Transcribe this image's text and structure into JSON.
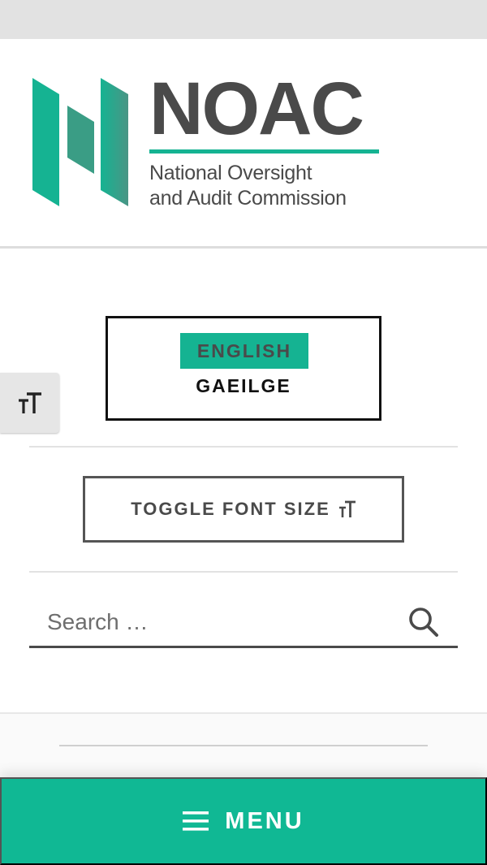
{
  "header": {
    "logo_word": "NOAC",
    "logo_sub_line1": "National Oversight",
    "logo_sub_line2": "and Audit Commission"
  },
  "language": {
    "english_label": "ENGLISH",
    "gaeilge_label": "GAEILGE",
    "selected": "ENGLISH"
  },
  "accessibility": {
    "toggle_font_label": "TOGGLE FONT SIZE",
    "tab_icon": "text-size-icon"
  },
  "search": {
    "placeholder": "Search …",
    "icon": "search-icon"
  },
  "menu": {
    "label": "MENU",
    "icon": "hamburger-icon"
  },
  "colors": {
    "brand_green": "#15b392",
    "menu_green": "#10b894",
    "text_dark": "#4a4a4a"
  }
}
